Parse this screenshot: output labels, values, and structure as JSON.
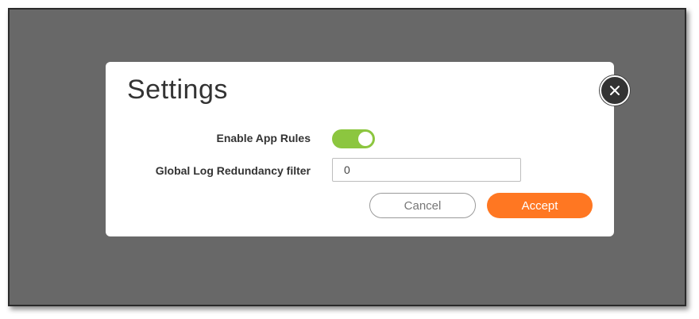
{
  "dialog": {
    "title": "Settings",
    "close_icon": "close-icon",
    "fields": {
      "enable_app_rules": {
        "label": "Enable App Rules",
        "value": "on",
        "color": "#8cc63f"
      },
      "global_log_redundancy": {
        "label": "Global Log Redundancy filter",
        "value": "0"
      }
    },
    "buttons": {
      "cancel": "Cancel",
      "accept": "Accept",
      "accept_color": "#ff7722"
    }
  }
}
